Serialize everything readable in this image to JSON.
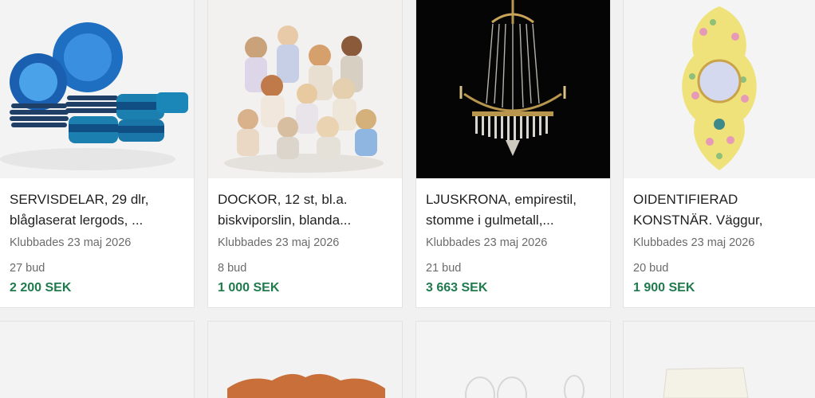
{
  "listings": [
    {
      "title_line1": "SERVISDELAR, 29 dlr,",
      "title_line2": "blåglaserat lergods, ...",
      "date": "Klubbades 23 maj 2026",
      "bids": "27 bud",
      "price": "2 200 SEK",
      "image": "blue-ceramic-tableware"
    },
    {
      "title_line1": "DOCKOR, 12 st, bl.a.",
      "title_line2": "biskviporslin, blanda...",
      "date": "Klubbades 23 maj 2026",
      "bids": "8 bud",
      "price": "1 000 SEK",
      "image": "porcelain-dolls"
    },
    {
      "title_line1": "LJUSKRONA, empirestil,",
      "title_line2": "stomme i gulmetall,...",
      "date": "Klubbades 23 maj 2026",
      "bids": "21 bud",
      "price": "3 663 SEK",
      "image": "crystal-chandelier"
    },
    {
      "title_line1": "OIDENTIFIERAD",
      "title_line2": "KONSTNÄR. Väggur,",
      "date": "Klubbades 23 maj 2026",
      "bids": "20 bud",
      "price": "1 900 SEK",
      "image": "floral-wall-clock"
    }
  ],
  "colors": {
    "price": "#1f7a4d",
    "background": "#f1f1f1"
  }
}
